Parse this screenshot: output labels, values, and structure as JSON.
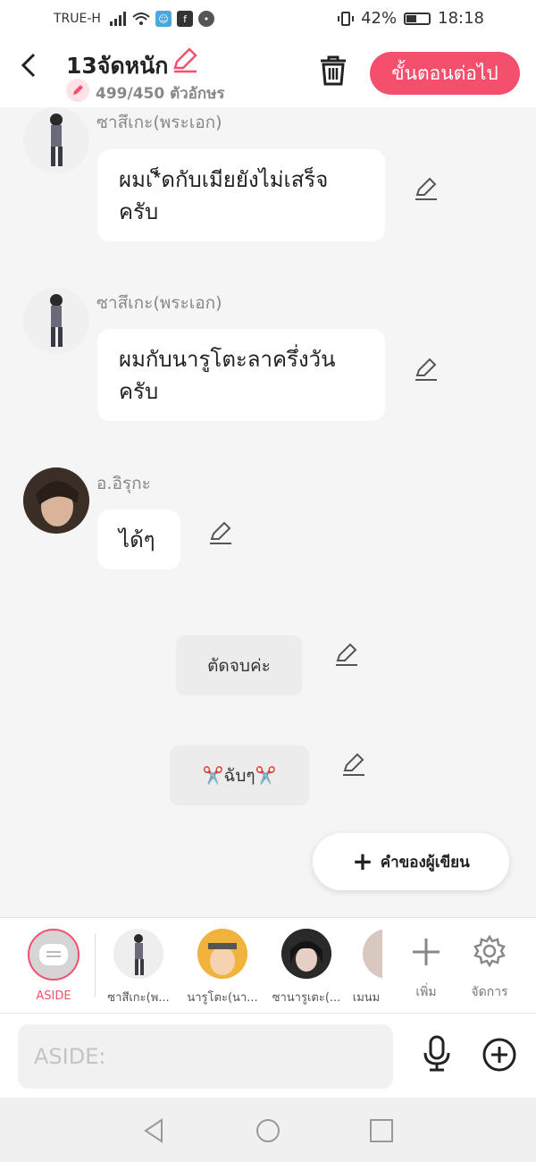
{
  "status": {
    "carrier": "TRUE-H",
    "battery": "42%",
    "time": "18:18"
  },
  "header": {
    "title": "13จัดหนัก",
    "counter": "499/450 ตัวอักษร",
    "next_label": "ขั้นตอนต่อไป",
    "accent": "#f4506d"
  },
  "messages": [
    {
      "sender": "ซาสึเกะ(พระเอก)",
      "text": "ผมเ*็ดกับเมียยังไม่เสร็จครับ"
    },
    {
      "sender": "ซาสึเกะ(พระเอก)",
      "text": "ผมกับนารูโตะลาครึ่งวันครับ"
    },
    {
      "sender": "อ.อิรุกะ",
      "text": "ได้ๆ"
    }
  ],
  "narrations": [
    {
      "text": "ตัดจบค่ะ"
    },
    {
      "text": "✂️ฉับๆ✂️"
    }
  ],
  "writer_button": "คำของผู้เขียน",
  "characters": [
    {
      "name": "ASIDE"
    },
    {
      "name": "ซาสึเกะ(พ..."
    },
    {
      "name": "นารูโตะ(นา..."
    },
    {
      "name": "ซานารูเตะ(..."
    },
    {
      "name": "เมนม"
    }
  ],
  "tools": {
    "add": "เพิ่ม",
    "manage": "จัดการ"
  },
  "input": {
    "placeholder": "ASIDE:"
  }
}
